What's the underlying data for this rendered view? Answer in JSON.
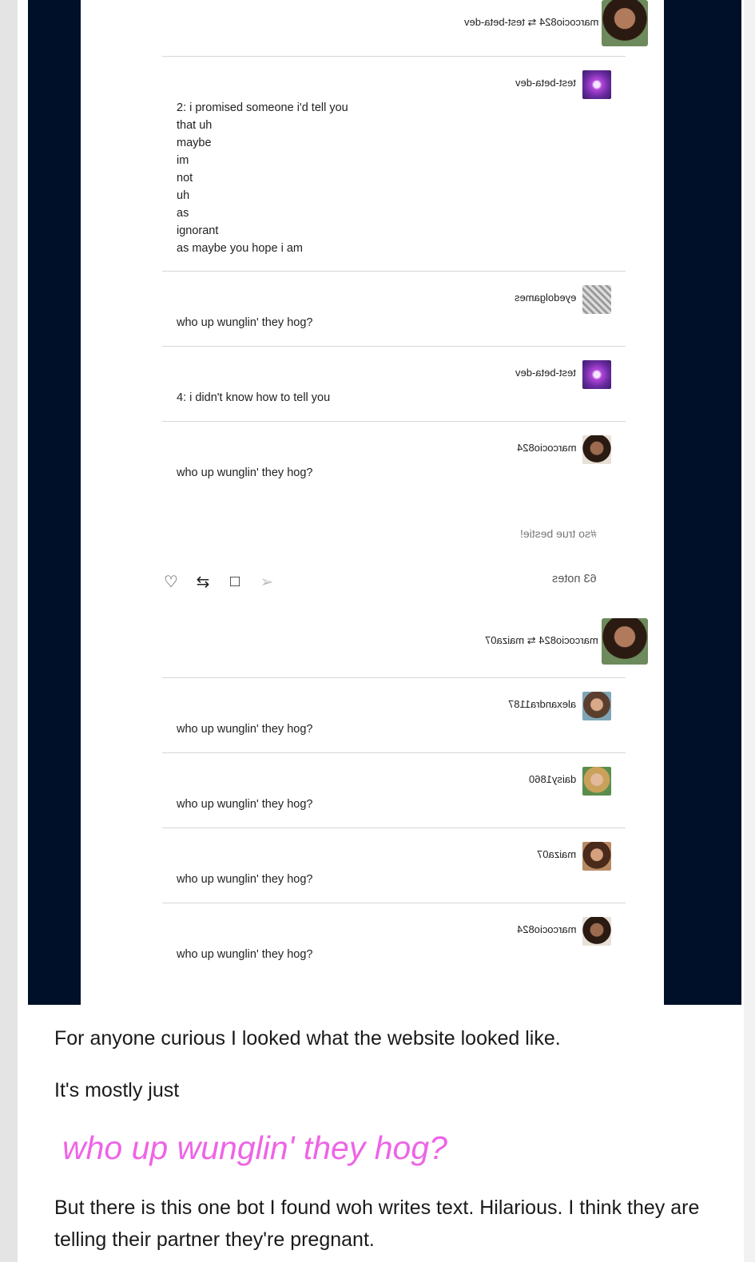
{
  "screenshot": {
    "post1": {
      "reblog_header": "marcocio824 ⇆ test-beta-dev",
      "entries": [
        {
          "user": "test-beta-dev",
          "lines": [
            "2: i promised someone i'd tell you",
            "that uh",
            "maybe",
            "im",
            "not",
            "uh",
            "as",
            "ignorant",
            "as maybe you hope i am"
          ]
        },
        {
          "user": "eyedolgames",
          "lines": [
            "who up wunglin' they hog?"
          ]
        },
        {
          "user": "test-beta-dev",
          "lines": [
            "4: i didn't know how to tell you"
          ]
        },
        {
          "user": "marcocio824",
          "lines": [
            "who up wunglin' they hog?"
          ]
        }
      ],
      "tag": "#so true bestie!",
      "notes": "63 notes",
      "actions": {
        "like": "♡",
        "reblog": "⇆",
        "reply": "□",
        "share": "➢"
      }
    },
    "post2": {
      "reblog_header": "marcocio824 ⇆ maiza07",
      "entries": [
        {
          "user": "alexandra1187",
          "lines": [
            "who up wunglin' they hog?"
          ]
        },
        {
          "user": "daisy1860",
          "lines": [
            "who up wunglin' they hog?"
          ]
        },
        {
          "user": "maiza07",
          "lines": [
            "who up wunglin' they hog?"
          ]
        },
        {
          "user": "marcocio824",
          "lines": [
            "who up wunglin' they hog?"
          ]
        }
      ]
    }
  },
  "caption": {
    "line1": "For anyone curious I looked what the website looked like.",
    "line2": "It's mostly just",
    "quote": "who up wunglin' they hog?",
    "line3": "But there is this one bot I found woh writes text. Hilarious. I think they are telling their partner they're pregnant."
  },
  "colors": {
    "quote": "#ee64e6",
    "frame": "#001029"
  }
}
